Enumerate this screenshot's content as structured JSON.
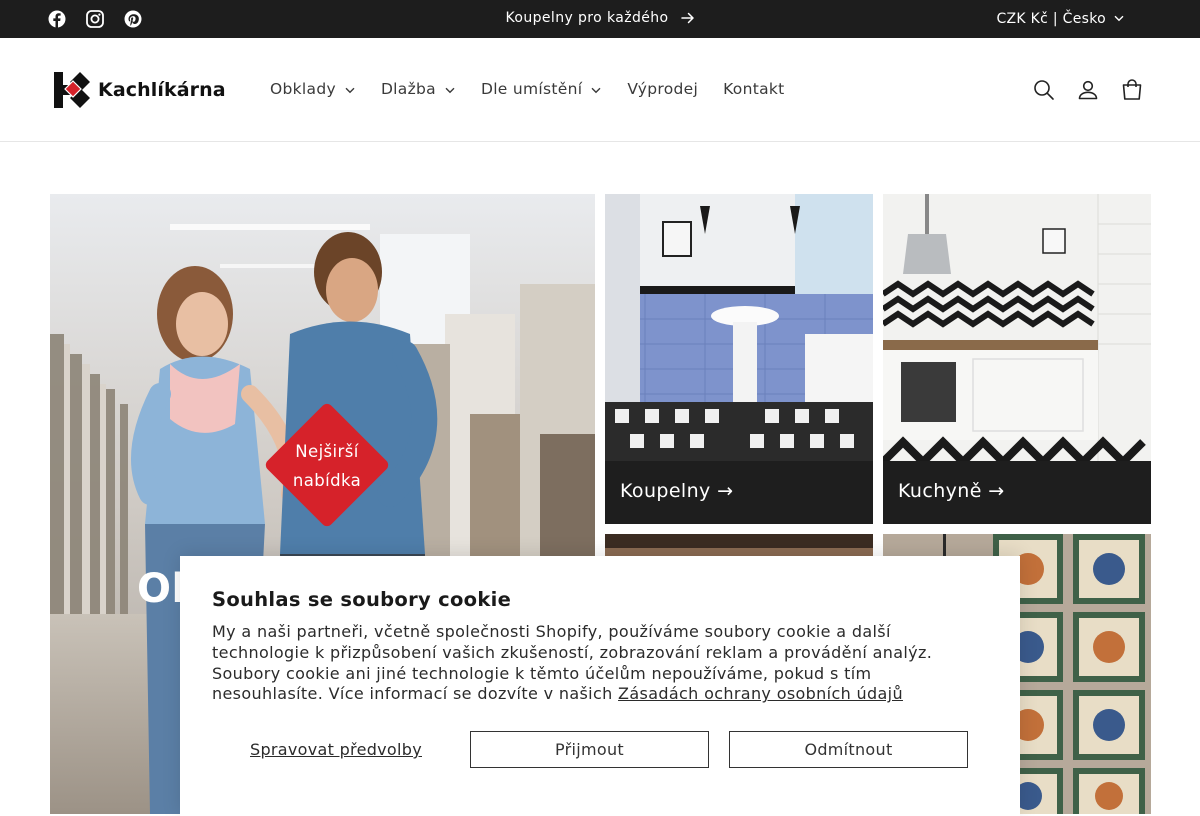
{
  "announcement": {
    "text": "Koupelny pro každého",
    "arrow_icon": "arrow-right-icon"
  },
  "social": [
    {
      "name": "facebook-icon"
    },
    {
      "name": "instagram-icon"
    },
    {
      "name": "pinterest-icon"
    }
  ],
  "locale": {
    "label": "CZK Kč | Česko"
  },
  "header": {
    "logo_text": "Kachlíkárna",
    "nav": [
      {
        "label": "Obklady",
        "dropdown": true
      },
      {
        "label": "Dlažba",
        "dropdown": true
      },
      {
        "label": "Dle umístění",
        "dropdown": true
      },
      {
        "label": "Výprodej",
        "dropdown": false
      },
      {
        "label": "Kontakt",
        "dropdown": false
      }
    ],
    "icons": [
      "search-icon",
      "account-icon",
      "cart-icon"
    ]
  },
  "hero": {
    "badge_line1": "Nejširší",
    "badge_line2": "nabídka",
    "title_partial": "Ob"
  },
  "tiles": [
    {
      "label": "Koupelny →"
    },
    {
      "label": "Kuchyně →"
    }
  ],
  "cookie": {
    "title": "Souhlas se soubory cookie",
    "body": "My a naši partneři, včetně společnosti Shopify, používáme soubory cookie a další technologie k přizpůsobení vašich zkušeností, zobrazování reklam a provádění analýz. Soubory cookie ani jiné technologie k těmto účelům nepoužíváme, pokud s tím nesouhlasíte. Více informací se dozvíte v našich",
    "link": "Zásadách ochrany osobních údajů",
    "manage": "Spravovat předvolby",
    "accept": "Přijmout",
    "decline": "Odmítnout"
  },
  "colors": {
    "topbar": "#1d1d1d",
    "brand_red": "#d6222a",
    "caption_bg": "#1e1e1e"
  }
}
